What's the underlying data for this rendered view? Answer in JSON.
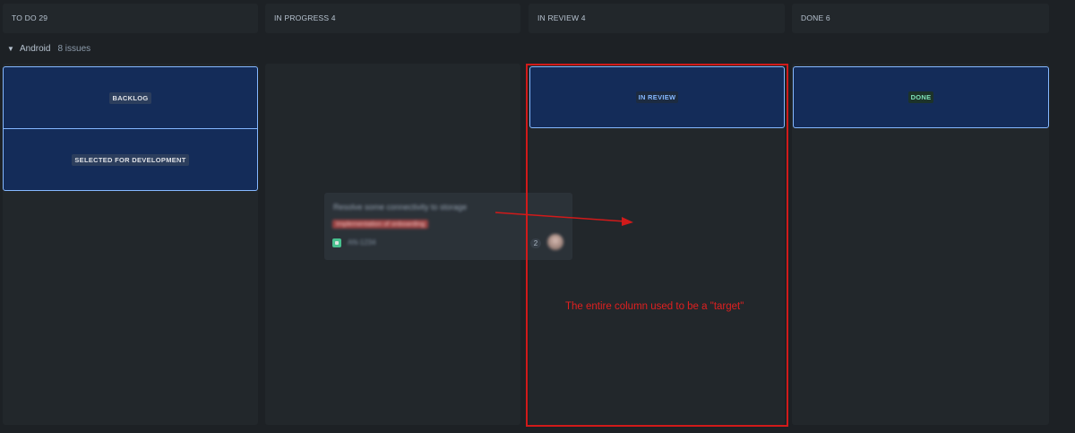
{
  "columns": [
    {
      "title": "TO DO 29"
    },
    {
      "title": "IN PROGRESS 4"
    },
    {
      "title": "IN REVIEW 4"
    },
    {
      "title": "DONE 6"
    }
  ],
  "swimlane": {
    "name": "Android",
    "count": "8 issues",
    "icon": "chevron-down-icon"
  },
  "drop_zones": {
    "todo": [
      "BACKLOG",
      "SELECTED FOR DEVELOPMENT"
    ],
    "in_review": "IN REVIEW",
    "done": "DONE"
  },
  "dragged_card": {
    "summary": "Resolve some connectivity to storage",
    "epic": "Implementation of onboarding",
    "key": "AN-1234",
    "story_points": "2",
    "type_icon": "story-icon",
    "epic_color": "#a54545"
  },
  "annotation": {
    "text": "The entire column used to be a \"target\"",
    "color": "#d11a1a"
  },
  "colors": {
    "background": "#1d2125",
    "column": "#22272b",
    "drop_zone_fill": "#142c59",
    "drop_zone_border": "#85b8ff"
  }
}
